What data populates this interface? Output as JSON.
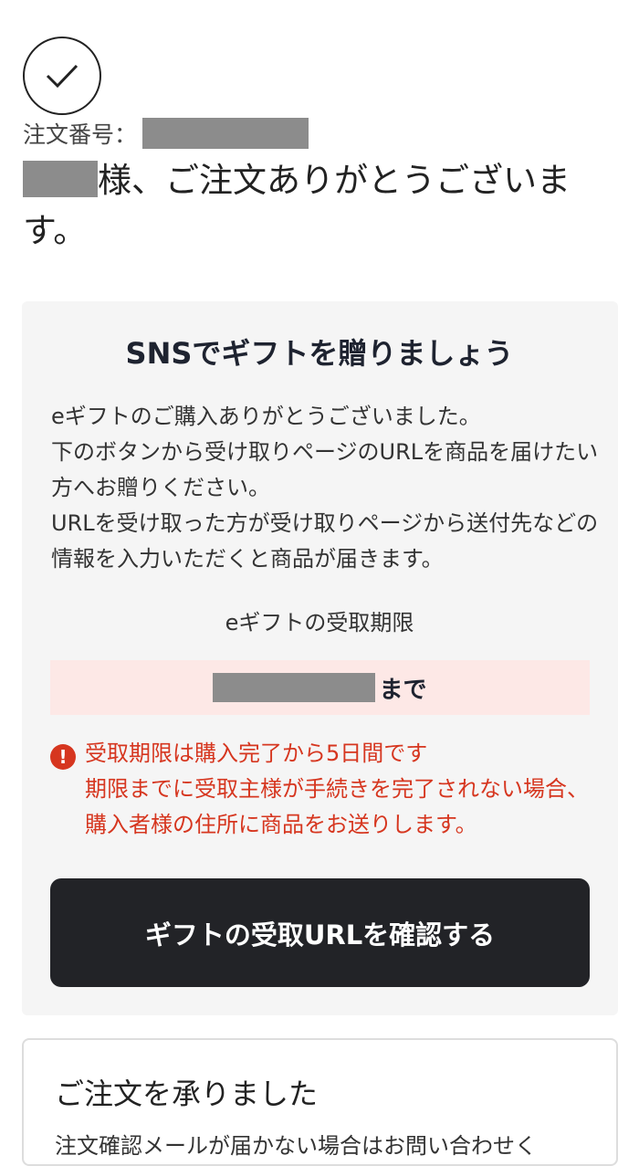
{
  "header": {
    "order_number_label": "注文番号：",
    "thanks_suffix": "様、ご注文ありがとうございます。"
  },
  "gift": {
    "title": "SNSでギフトを贈りましょう",
    "description_lines": [
      "eギフトのご購入ありがとうございました。",
      "下のボタンから受け取りページのURLを商品を届けたい方へお贈りください。",
      "URLを受け取った方が受け取りページから送付先などの情報を入力いただくと商品が届きます。"
    ],
    "deadline_label": "eギフトの受取期限",
    "deadline_suffix": "まで",
    "warning_lines": [
      "受取期限は購入完了から5日間です",
      "期限までに受取主様が手続きを完了されない場合、購入者様の住所に商品をお送りします。"
    ],
    "button_label": "ギフトの受取URLを確認する"
  },
  "order_card": {
    "title": "ご注文を承りました",
    "subtitle": "注文確認メールが届かない場合はお問い合わせく"
  },
  "colors": {
    "warning": "#d6361f",
    "deadline_bg": "#fde8e6",
    "button_bg": "#222327",
    "panel_bg": "#f5f5f5"
  },
  "icons": {
    "success": "check-circle-icon",
    "warning": "exclamation-circle-icon"
  }
}
